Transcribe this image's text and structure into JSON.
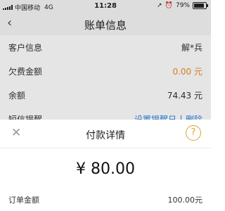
{
  "status_bar": {
    "carrier": "中国移动",
    "network": "4G",
    "time": "11:28",
    "battery_text": "79%",
    "battery_level": 0.79
  },
  "nav": {
    "back_icon": "back-chevron-icon",
    "title": "账单信息"
  },
  "info_rows": [
    {
      "label": "客户信息",
      "value": "解*兵"
    },
    {
      "label": "欠费金额",
      "value": "0.00 元",
      "color": "#f08a2a"
    },
    {
      "label": "余额",
      "value": "74.43 元"
    }
  ],
  "sms": {
    "label": "短信提醒",
    "set_reminder": "设置提醒日",
    "delete": "删除"
  },
  "sheet": {
    "title": "付款详情",
    "close_icon": "close-icon",
    "help_icon": "help-icon",
    "help_symbol": "?",
    "amount": "¥ 80.00",
    "order": {
      "label": "订单金额",
      "value": "100.00元"
    }
  },
  "colors": {
    "accent_blue": "#2a82e4",
    "warning_orange": "#f08a2a",
    "help_gold": "#d4a72c"
  }
}
